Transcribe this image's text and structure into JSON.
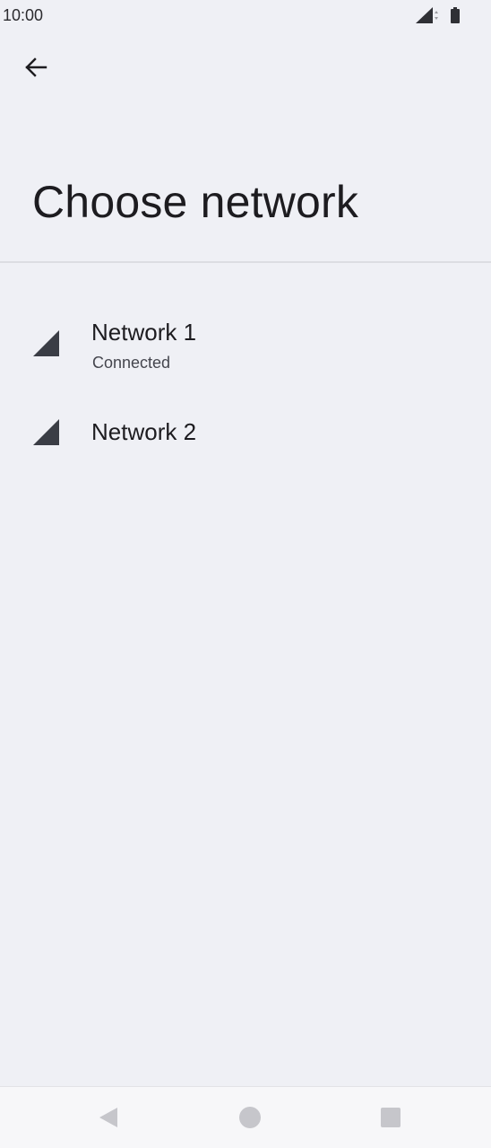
{
  "status_bar": {
    "time": "10:00",
    "icons": [
      "cellular-signal-icon",
      "data-arrows-icon",
      "battery-icon"
    ]
  },
  "header": {
    "back_icon": "arrow-back-icon",
    "title": "Choose network"
  },
  "networks": [
    {
      "name": "Network 1",
      "status": "Connected",
      "icon": "signal-icon"
    },
    {
      "name": "Network 2",
      "status": "",
      "icon": "signal-icon"
    }
  ],
  "nav_bar": {
    "buttons": [
      "back-triangle-icon",
      "home-circle-icon",
      "recents-square-icon"
    ]
  },
  "colors": {
    "background": "#eff0f5",
    "text_primary": "#1d1c20",
    "text_secondary": "#45464e",
    "icon": "#3a3d45",
    "nav_icon": "#c6c6cb"
  }
}
